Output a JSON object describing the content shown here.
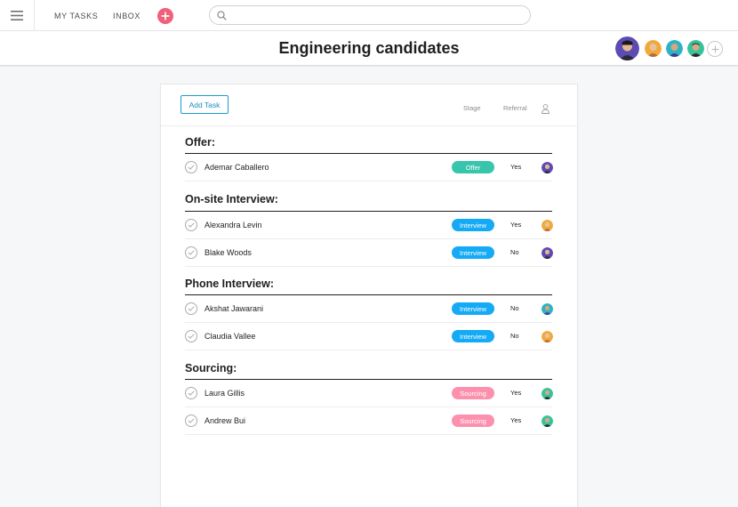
{
  "topbar": {
    "my_tasks": "MY TASKS",
    "inbox": "INBOX",
    "search": {
      "value": "",
      "placeholder": ""
    }
  },
  "header": {
    "title": "Engineering candidates",
    "members": [
      "avatar-purple",
      "avatar-orange",
      "avatar-teal",
      "avatar-green"
    ]
  },
  "toolbar": {
    "add_task": "Add Task",
    "columns": {
      "stage": "Stage",
      "referral": "Referral"
    }
  },
  "sections": [
    {
      "title": "Offer:",
      "rows": [
        {
          "name": "Ademar Caballero",
          "stage": "Offer",
          "referral": "Yes",
          "avatar": "purple"
        }
      ]
    },
    {
      "title": "On-site Interview:",
      "rows": [
        {
          "name": "Alexandra Levin",
          "stage": "Interview",
          "referral": "Yes",
          "avatar": "orange"
        },
        {
          "name": "Blake Woods",
          "stage": "Interview",
          "referral": "No",
          "avatar": "purple"
        }
      ]
    },
    {
      "title": "Phone Interview:",
      "rows": [
        {
          "name": "Akshat Jawarani",
          "stage": "Interview",
          "referral": "No",
          "avatar": "teal"
        },
        {
          "name": "Claudia Vallee",
          "stage": "Interview",
          "referral": "No",
          "avatar": "orange"
        }
      ]
    },
    {
      "title": "Sourcing:",
      "rows": [
        {
          "name": "Laura Gillis",
          "stage": "Sourcing",
          "referral": "Yes",
          "avatar": "green"
        },
        {
          "name": "Andrew Bui",
          "stage": "Sourcing",
          "referral": "Yes",
          "avatar": "green"
        }
      ]
    }
  ],
  "colors": {
    "offer": "#37c5ab",
    "interview": "#14aaf5",
    "sourcing": "#fc91ad",
    "accent": "#f0607a",
    "primary_button": "#1d9bd1"
  }
}
